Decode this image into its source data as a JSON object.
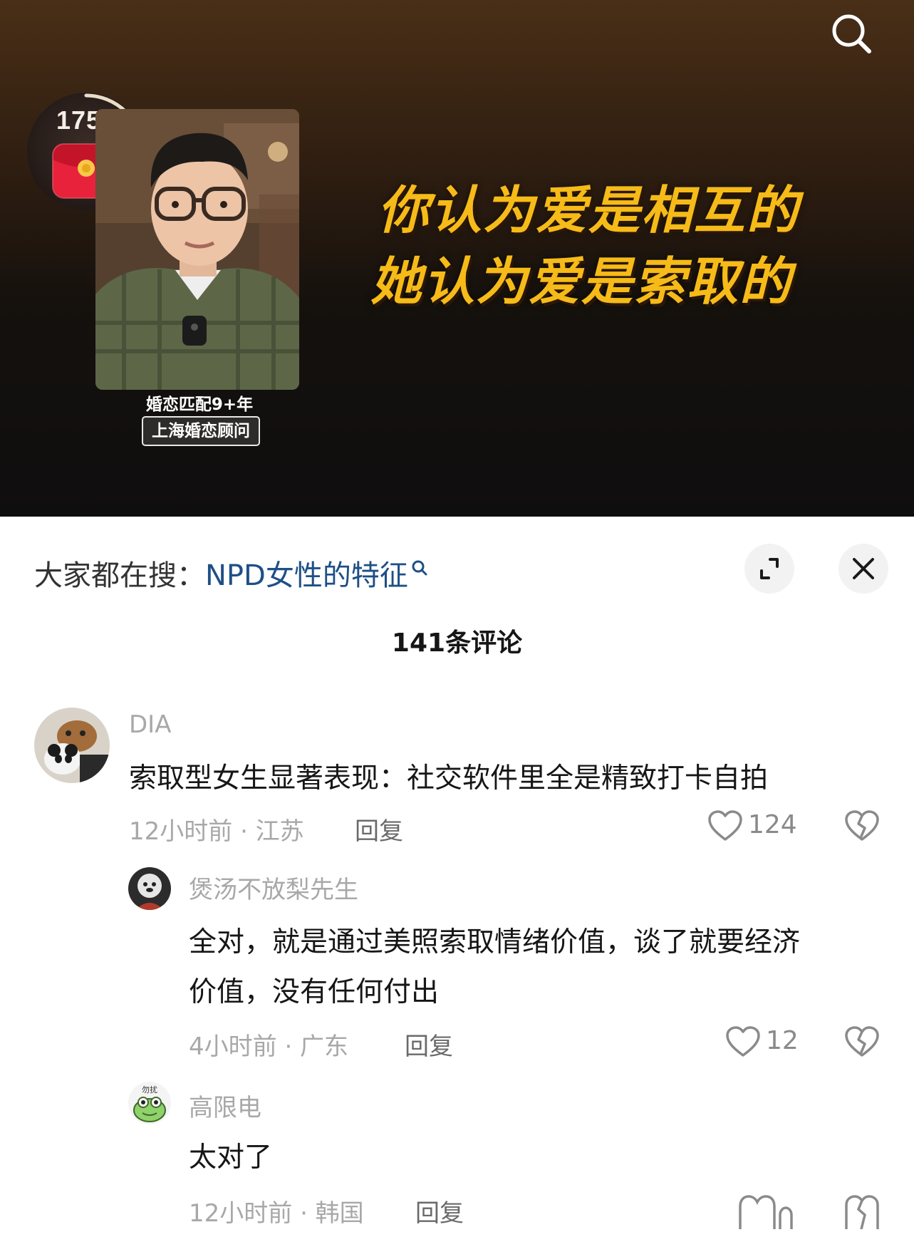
{
  "video": {
    "redpacket_count": "1754",
    "slogan_line1": "你认为爱是相互的",
    "slogan_line2": "她认为爱是索取的",
    "caption_line1": "婚恋匹配9+年",
    "caption_line2": "上海婚恋顾问",
    "icons": {
      "search": "search-icon",
      "redpacket": "red-envelope-icon"
    }
  },
  "sheet": {
    "trending_prefix": "大家都在搜：",
    "trending_topic": "NPD女性的特征",
    "comment_count": "141条评论",
    "icons": {
      "expand": "expand-icon",
      "close": "close-icon"
    }
  },
  "comments": [
    {
      "user": "DIA",
      "text": "索取型女生显著表现：社交软件里全是精致打卡自拍",
      "time_location": "12小时前 · 江苏",
      "reply_label": "回复",
      "likes": "124"
    },
    {
      "user": "煲汤不放梨先生",
      "text_line1": "全对，就是通过美照索取情绪价值，谈了就要经济",
      "text_line2": "价值，没有任何付出",
      "time_location": "4小时前 · 广东",
      "reply_label": "回复",
      "likes": "12"
    },
    {
      "user": "高限电",
      "text": "太对了",
      "time_location": "12小时前 · 韩国",
      "reply_label": "回复",
      "avatar_badge": "勿扰"
    }
  ],
  "colors": {
    "link": "#1e4f86",
    "slogan": "#f6bb18",
    "muted": "#a8a8a8"
  }
}
